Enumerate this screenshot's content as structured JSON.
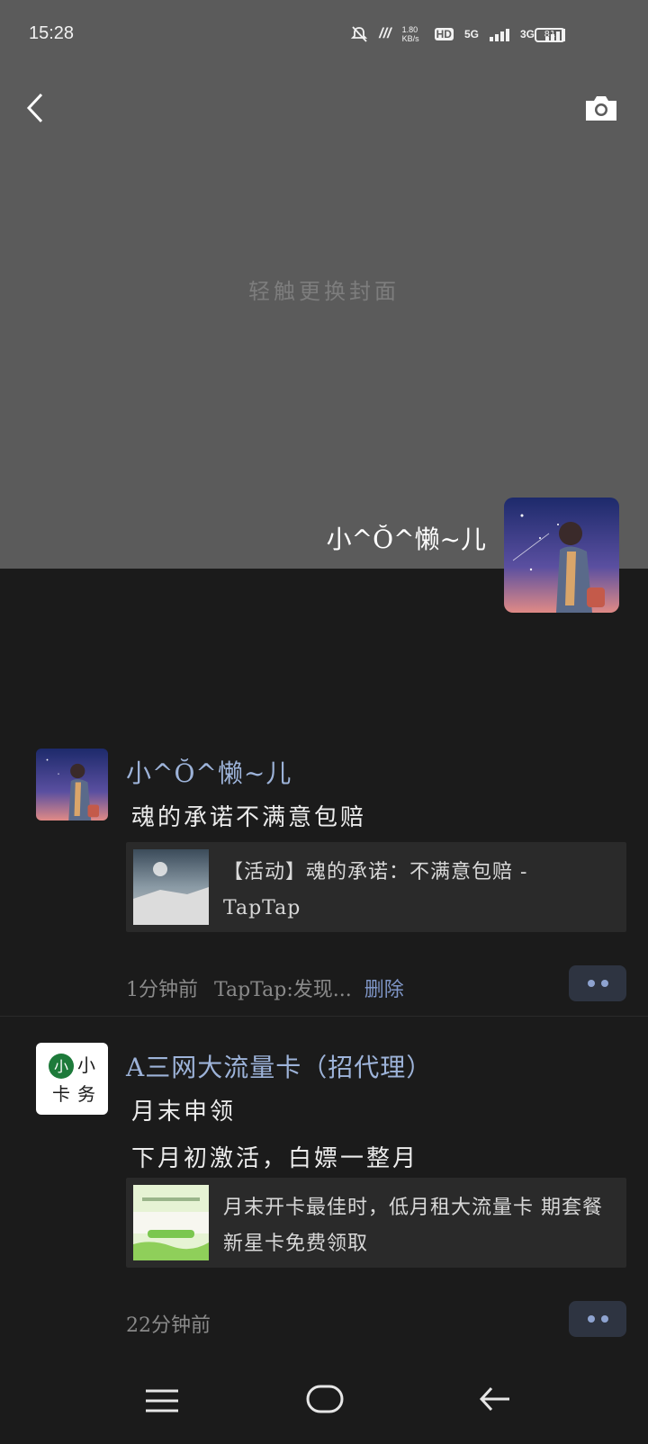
{
  "status_bar": {
    "time": "15:28",
    "net_speed": "1.80 KB/s",
    "hd_label": "HD",
    "signal1_label": "5G",
    "signal2_label": "3G",
    "battery": "81"
  },
  "cover": {
    "hint": "轻触更换封面",
    "user_name": "小^Ŏ^懒~儿"
  },
  "posts": [
    {
      "name": "小^Ŏ^懒~儿",
      "text_lines": [
        "魂的承诺不满意包赔"
      ],
      "card_title": "【活动】魂的承诺：不满意包赔 - TapTap",
      "time": "1分钟前",
      "source": "TapTap:发现...",
      "delete": "删除"
    },
    {
      "name": "A三网大流量卡（招代理）",
      "text_lines": [
        "月末申领",
        "下月初激活，白嫖一整月"
      ],
      "card_title": "月末开卡最佳时，低月租大流量卡 期套餐新星卡免费领取",
      "time": "22分钟前"
    }
  ],
  "colors": {
    "cover_bg": "#5b5b5b",
    "page_bg": "#1b1b1b",
    "name_accent": "#9db3d9"
  }
}
